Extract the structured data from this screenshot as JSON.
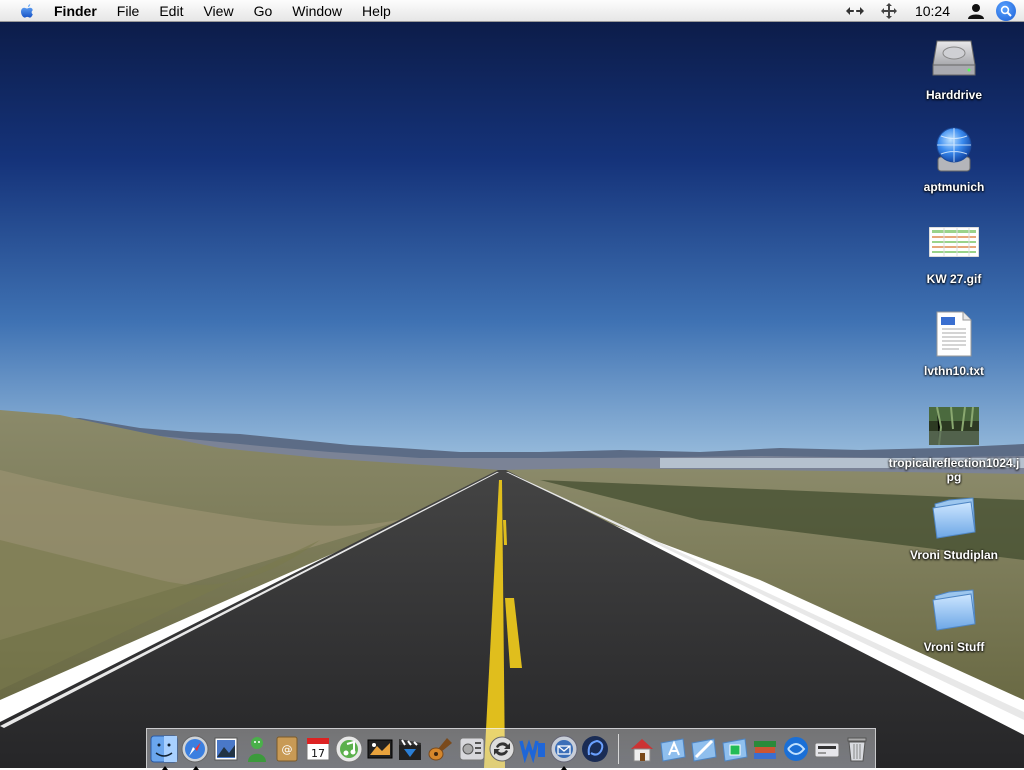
{
  "menubar": {
    "app_name": "Finder",
    "menus": [
      "File",
      "Edit",
      "View",
      "Go",
      "Window",
      "Help"
    ],
    "clock": "10:24",
    "status_icons": [
      "network-arrows-icon",
      "move-cross-icon",
      "user-icon",
      "spotlight-search-icon"
    ]
  },
  "desktop": {
    "icons": [
      {
        "label": "Harddrive",
        "icon": "hard-drive-icon"
      },
      {
        "label": "aptmunich",
        "icon": "network-volume-icon"
      },
      {
        "label": "KW 27.gif",
        "icon": "gif-image-file-icon"
      },
      {
        "label": "lvthn10.txt",
        "icon": "text-document-icon"
      },
      {
        "label": "tropicalreflection1024.jpg",
        "icon": "jpg-image-file-icon"
      },
      {
        "label": "Vroni Studiplan",
        "icon": "folder-icon"
      },
      {
        "label": "Vroni Stuff",
        "icon": "folder-icon"
      }
    ]
  },
  "dock": {
    "apps": [
      "finder-icon",
      "safari-icon",
      "preview-icon",
      "messenger-icon",
      "address-book-icon",
      "ical-icon",
      "itunes-icon",
      "iphoto-icon",
      "imovie-icon",
      "garageband-icon",
      "system-preferences-icon",
      "sync-icon",
      "word-icon",
      "mail-icon",
      "browser-icon"
    ],
    "docs": [
      "home-folder-icon",
      "applications-folder-icon",
      "internet-folder-icon",
      "documents-folder-icon",
      "library-books-icon",
      "network-icon",
      "card-reader-icon",
      "trash-icon"
    ],
    "calendar_day": "17"
  },
  "colors": {
    "sky_top": "#0d1d4a",
    "sky_bottom": "#8fb4d9",
    "road": "#2e2e30",
    "road_line": "#e3c21b",
    "accent": "#1b5fd6"
  }
}
